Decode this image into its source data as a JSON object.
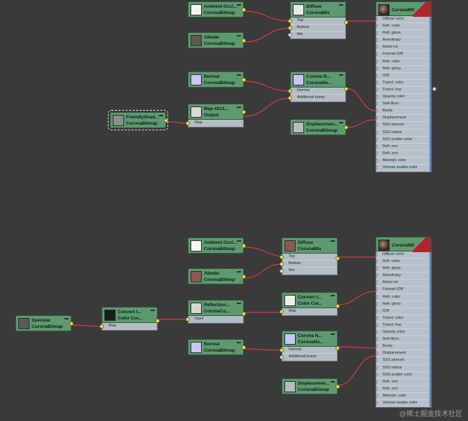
{
  "colors": {
    "node": "#5d9a70",
    "wire": "#d63c3c",
    "port": "#e4e84a",
    "mat_accent": "#b0242b"
  },
  "materials": [
    {
      "title": "CoronaMtl",
      "rows": [
        "Diffuse color",
        "Refl. color",
        "Refl. gloss.",
        "Anisotropy",
        "Aniso rot.",
        "Fresnel IOR",
        "Refr. color",
        "Refr. gloss.",
        "IOR",
        "Transl. color",
        "Transl. frac",
        "Opacity color",
        "Self-Illum.",
        "Bump",
        "Displacement",
        "SSS amount",
        "SSS radius",
        "SSS scatter color",
        "Refl. env",
        "Refr. env",
        "Absorpt. color",
        "Volume scatter color"
      ]
    },
    {
      "title": "CoronaMtl",
      "rows": [
        "Diffuse color",
        "Refl. color",
        "Refl. gloss.",
        "Anisotropy",
        "Aniso rot.",
        "Fresnel IOR",
        "Refr. color",
        "Refr. gloss",
        "IOR",
        "Transl. color",
        "Transl. frac",
        "Opacity color",
        "Self-Illum.",
        "Bump",
        "Displacement",
        "SSS amount",
        "SSS radius",
        "SSS scatter color",
        "Refl. env",
        "Refr. env",
        "Absorpt. color",
        "Volume scatter color"
      ]
    }
  ],
  "nodes": [
    {
      "t1": "Ambient Occl...",
      "t2": "CoronaBitmap",
      "swatch": "#f5f5f5",
      "rows": []
    },
    {
      "t1": "Albedo",
      "t2": "CoronaBitmap",
      "swatch": "#5e5850",
      "rows": []
    },
    {
      "t1": "Diffuse",
      "t2": "CoronaMix",
      "swatch": "#e9e9e9",
      "rows": [
        "Top",
        "Bottom",
        "Mix"
      ]
    },
    {
      "t1": "Normal",
      "t2": "CoronaBitmap",
      "swatch": "#c9c6f4",
      "rows": []
    },
    {
      "t1": "Corona N...",
      "t2": "CoronaNo...",
      "swatch": "#c9c6f4",
      "rows": [
        "Normal",
        "Additional bump"
      ]
    },
    {
      "t1": "FriendlyShad...",
      "t2": "CoronaBitmap",
      "swatch": "#8b8f8c",
      "rows": []
    },
    {
      "t1": "Map #213...",
      "t2": "Output",
      "swatch": "#d9d9d9",
      "rows": [
        "Map"
      ]
    },
    {
      "t1": "Displacemen...",
      "t2": "CoronaBitmap",
      "swatch": "#b9bcbd",
      "rows": []
    },
    {
      "t1": "Ambient Occl...",
      "t2": "CoronaBitmap",
      "swatch": "#f5f5f5",
      "rows": []
    },
    {
      "t1": "Albedo",
      "t2": "CoronaBitmap",
      "swatch": "#8a5a4e",
      "rows": []
    },
    {
      "t1": "Diffuse",
      "t2": "CoronaMix",
      "swatch": "#8a5a4e",
      "rows": [
        "Top",
        "Bottom",
        "Mix"
      ]
    },
    {
      "t1": "Specular",
      "t2": "CoronaBitmap",
      "swatch": "#5a5a5a",
      "rows": []
    },
    {
      "t1": "Convert t...",
      "t2": "Color Cor...",
      "swatch": "#1c1c1c",
      "rows": [
        "Map"
      ]
    },
    {
      "t1": "Reflection...",
      "t2": "CoronaCo...",
      "swatch": "#d6d6d6",
      "rows": [
        "Input"
      ]
    },
    {
      "t1": "Convert t...",
      "t2": "Color Cor...",
      "swatch": "#eeeeee",
      "rows": [
        "Map"
      ]
    },
    {
      "t1": "Normal",
      "t2": "CoronaBitmap",
      "swatch": "#c9c6f4",
      "rows": []
    },
    {
      "t1": "Corona N...",
      "t2": "CoronaNo...",
      "swatch": "#c9c6f4",
      "rows": [
        "Normal",
        "Additional bump"
      ]
    },
    {
      "t1": "Displacemen...",
      "t2": "CoronaBitmap",
      "swatch": "#b9bcbd",
      "rows": []
    }
  ],
  "watermark": "@稀土掘金技术社区"
}
